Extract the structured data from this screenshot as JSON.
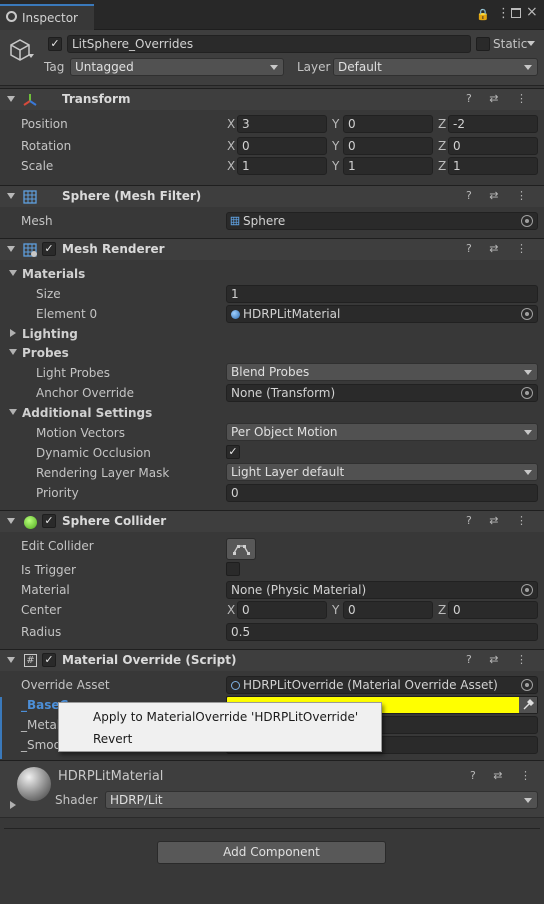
{
  "tab": {
    "title": "Inspector"
  },
  "gameobject": {
    "name": "LitSphere_Overrides",
    "static_label": "Static",
    "tag_label": "Tag",
    "tag_value": "Untagged",
    "layer_label": "Layer",
    "layer_value": "Default",
    "active": true
  },
  "transform": {
    "title": "Transform",
    "position": {
      "label": "Position",
      "x": "3",
      "y": "0",
      "z": "-2"
    },
    "rotation": {
      "label": "Rotation",
      "x": "0",
      "y": "0",
      "z": "0"
    },
    "scale": {
      "label": "Scale",
      "x": "1",
      "y": "1",
      "z": "1"
    },
    "axis": {
      "x": "X",
      "y": "Y",
      "z": "Z"
    }
  },
  "mesh_filter": {
    "title": "Sphere (Mesh Filter)",
    "mesh_label": "Mesh",
    "mesh_value": "Sphere"
  },
  "mesh_renderer": {
    "title": "Mesh Renderer",
    "materials_label": "Materials",
    "size_label": "Size",
    "size_value": "1",
    "element0_label": "Element 0",
    "element0_value": "HDRPLitMaterial",
    "lighting_label": "Lighting",
    "probes_label": "Probes",
    "light_probes_label": "Light Probes",
    "light_probes_value": "Blend Probes",
    "anchor_label": "Anchor Override",
    "anchor_value": "None (Transform)",
    "additional_label": "Additional Settings",
    "motion_label": "Motion Vectors",
    "motion_value": "Per Object Motion",
    "dyn_occ_label": "Dynamic Occlusion",
    "rlm_label": "Rendering Layer Mask",
    "rlm_value": "Light Layer default",
    "priority_label": "Priority",
    "priority_value": "0"
  },
  "sphere_collider": {
    "title": "Sphere Collider",
    "edit_label": "Edit Collider",
    "trigger_label": "Is Trigger",
    "material_label": "Material",
    "material_value": "None (Physic Material)",
    "center_label": "Center",
    "center_x": "0",
    "center_y": "0",
    "center_z": "0",
    "radius_label": "Radius",
    "radius_value": "0.5"
  },
  "material_override": {
    "title": "Material Override (Script)",
    "asset_label": "Override Asset",
    "asset_value": "HDRPLitOverride (Material Override Asset)",
    "base_label": "_BaseC",
    "metal_label": "_Metal",
    "smooth_label": "_Smoo",
    "base_color": "#ffff00"
  },
  "context_menu": {
    "apply": "Apply to MaterialOverride 'HDRPLitOverride'",
    "revert": "Revert"
  },
  "material_preview": {
    "name": "HDRPLitMaterial",
    "shader_label": "Shader",
    "shader_value": "HDRP/Lit"
  },
  "add_component": "Add Component",
  "colors": {
    "accent": "#3a79bb",
    "highlight": "#ffff00",
    "override_label": "#4c8fd8"
  }
}
